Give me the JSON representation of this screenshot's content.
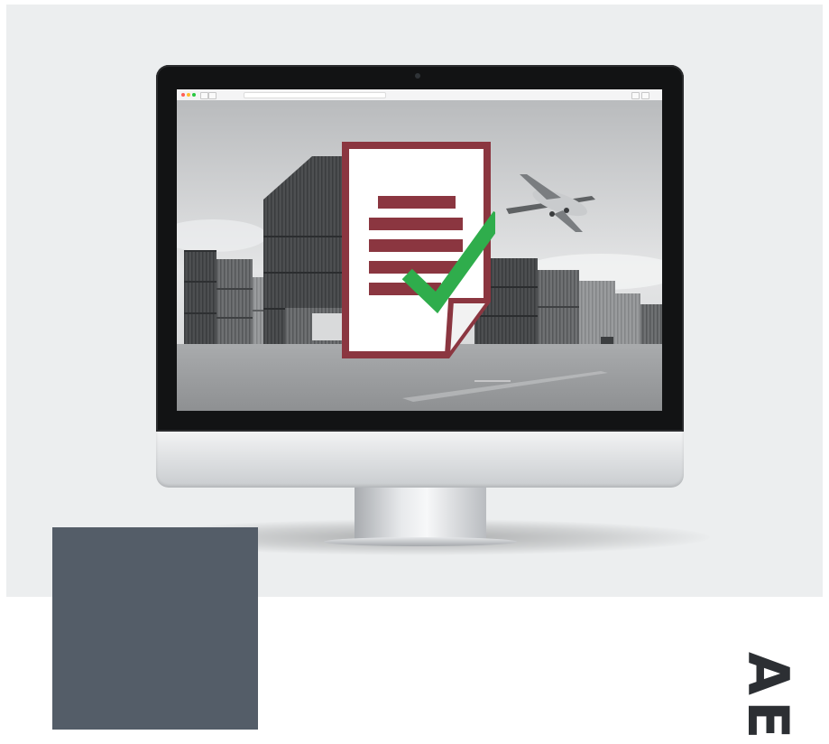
{
  "hero": {
    "browser": {
      "traffic_lights": [
        "#ff5f57",
        "#febc2e",
        "#28c840"
      ]
    },
    "illustration": {
      "subject": "document-check-icon",
      "document_color": "#8b3640",
      "check_color": "#2fad4c"
    }
  },
  "overlay": {
    "box_color": "#545d68"
  },
  "side_title": {
    "text": "AE"
  }
}
